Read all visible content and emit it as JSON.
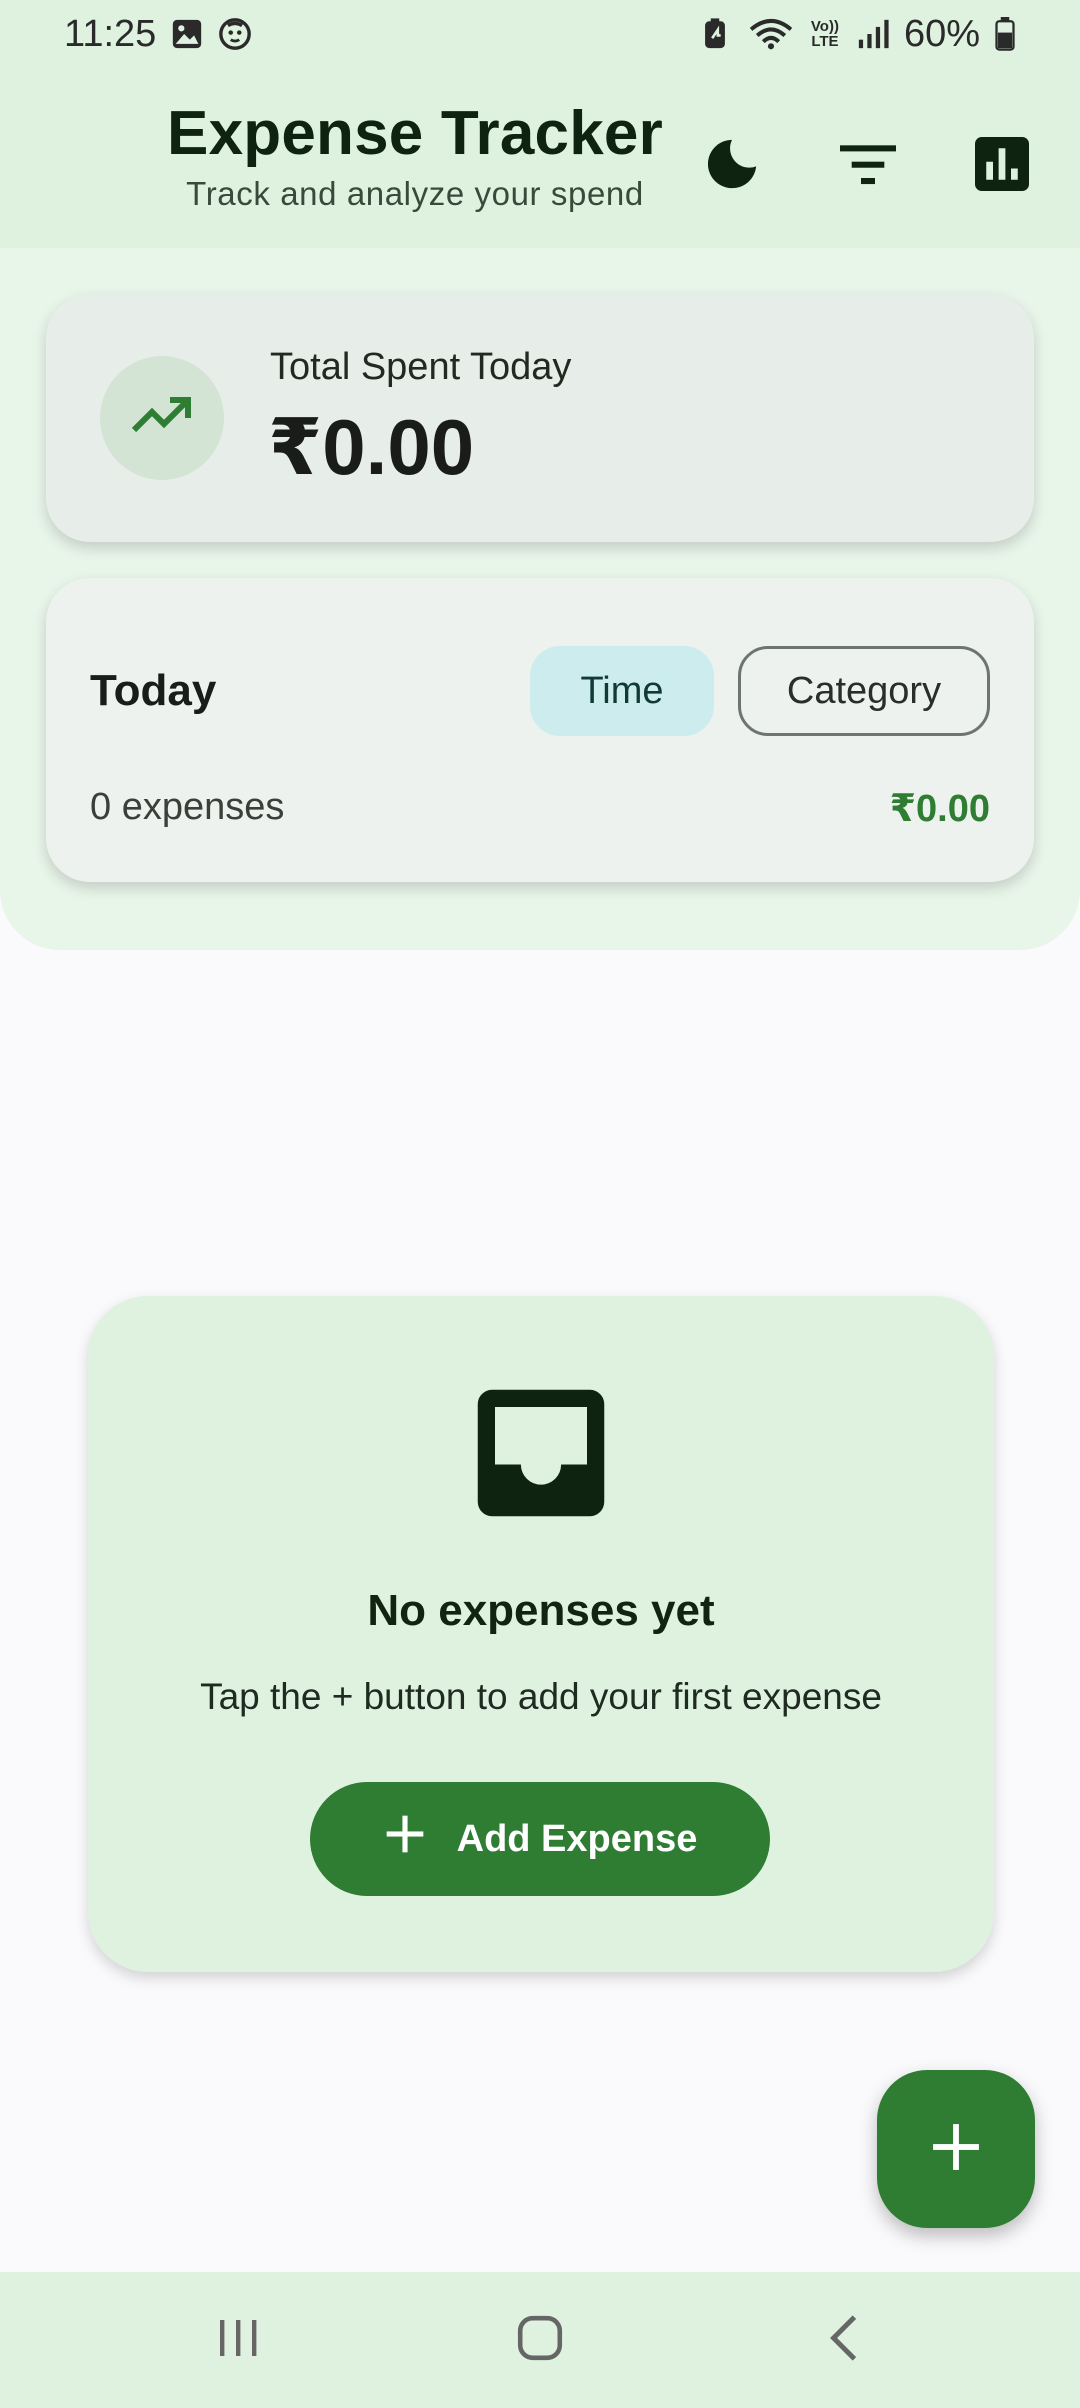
{
  "status_bar": {
    "time": "11:25",
    "battery": "60%",
    "left_icons": [
      "gallery-icon",
      "face-icon"
    ],
    "right_icons": [
      "battery-saver-icon",
      "wifi-icon",
      "volte-icon",
      "signal-icon",
      "battery-icon"
    ],
    "volte_label": "Vo)) LTE"
  },
  "header": {
    "title": "Expense Tracker",
    "subtitle": "Track and analyze your spend",
    "actions": [
      "dark-mode-icon",
      "filter-icon",
      "bar-chart-icon"
    ]
  },
  "total_card": {
    "label": "Total Spent Today",
    "value": "₹0.00",
    "icon": "trending-up-icon"
  },
  "today_card": {
    "label": "Today",
    "chips": [
      "Time",
      "Category"
    ],
    "selected_chip": "Time",
    "count_text": "0 expenses",
    "sum_text": "₹0.00"
  },
  "empty_state": {
    "icon": "inbox-icon",
    "title": "No expenses yet",
    "subtitle": "Tap the + button to add your first expense",
    "button_label": "Add Expense"
  },
  "fab": {
    "icon": "plus-icon"
  },
  "nav": {
    "buttons": [
      "recents-icon",
      "home-icon",
      "back-icon"
    ]
  },
  "colors": {
    "primary": "#2e7d32",
    "surface_tint": "#dff2e0",
    "header_panel": "#e8f5e9",
    "chip_selected": "#cdeced"
  }
}
